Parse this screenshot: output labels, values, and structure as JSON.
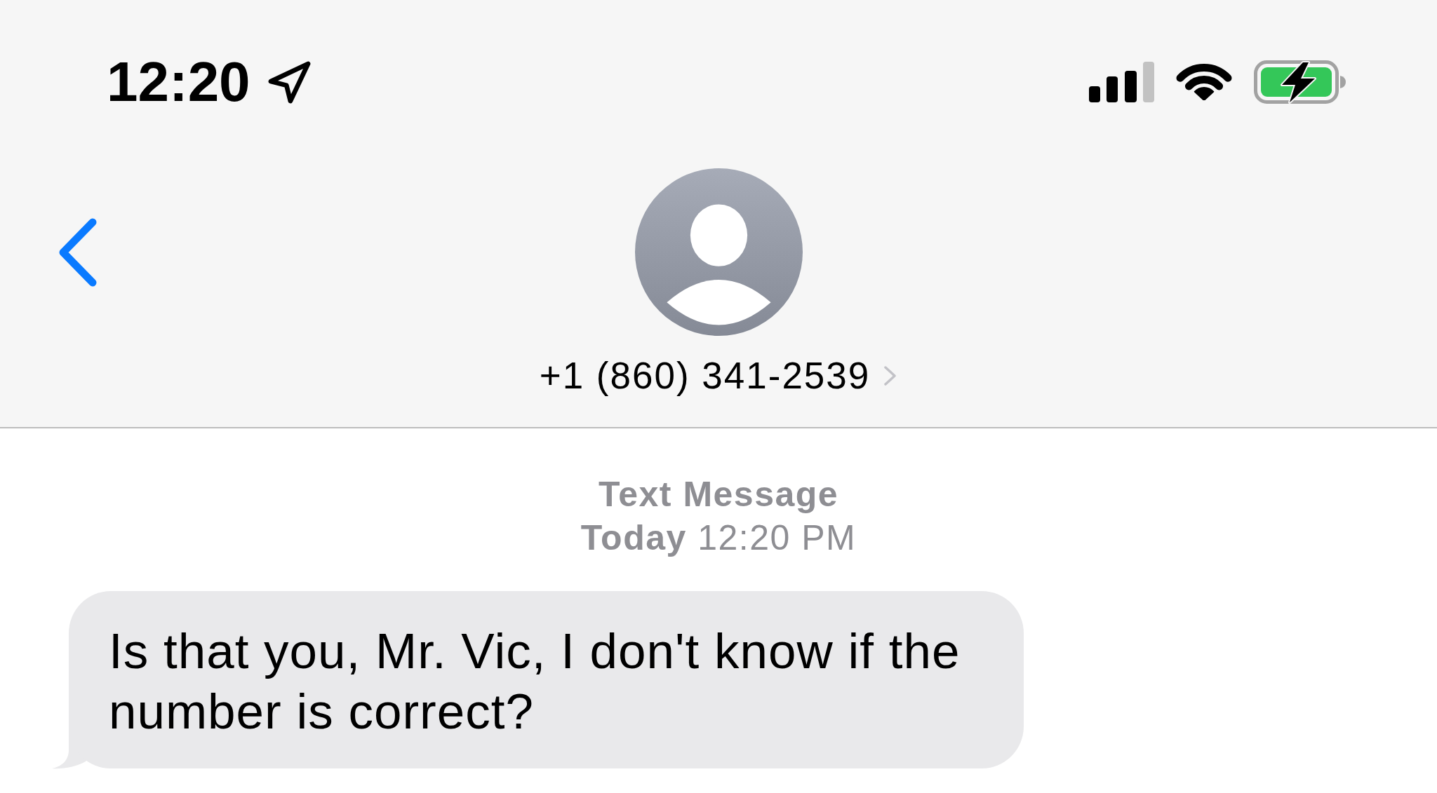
{
  "status_bar": {
    "time": "12:20"
  },
  "header": {
    "contact": "+1 (860) 341-2539"
  },
  "conversation": {
    "service_label": "Text Message",
    "timestamp": "**Today** 12:20 PM",
    "messages": [
      {
        "kind": "received",
        "text": "Is that you, Mr. Vic, I don't know if the number is correct?"
      }
    ]
  }
}
